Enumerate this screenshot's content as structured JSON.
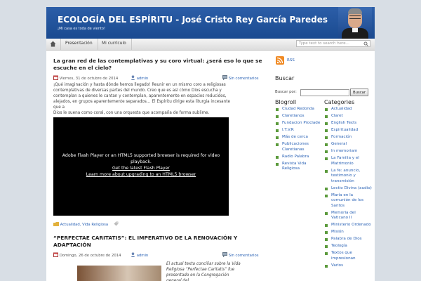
{
  "header": {
    "title": "ECOLOGÍA DEL ESPÍRITU - José Cristo Rey García Paredes",
    "tagline": "¡Mi casa es toda de viento!"
  },
  "nav": {
    "items": [
      "Presentación",
      "Mi currículo"
    ],
    "search_placeholder": "Type text to search here..."
  },
  "posts": [
    {
      "title_line1": "La gran red de las contemplativas y su coro virtual: ¿será eso lo que se",
      "title_line2": "escuche en el cielo?",
      "date": "Viernes, 31 de octubre de 2014",
      "author": "admin",
      "comments": "Sin comentarios",
      "excerpt": [
        "¡Qué imaginación y hasta dónde hemos llegado! Reunir en un mismo coro a religiosas",
        "contemplativas de diversas partes del mundo. Creo que es así cómo Dios escucha y",
        "contemplan a quienes le cantan y contemplan, aparentemente en espacios reducidos,",
        "alejados, en grupos aparentemente separados… El Espíritu dirige esta liturgia incesante que a",
        "Dios le suena como coral, con una orquesta que acompaña de forma sublime."
      ],
      "video": {
        "line1": "Adobe Flash Player or an HTML5 supported browser is required for video",
        "line2": "playback.",
        "link1": "Get the latest Flash Player",
        "link2": "Learn more about upgrading to an HTML5 browser"
      },
      "categories": "Actualidad, Vida Religiosa"
    },
    {
      "title_line1": "“PERFECTAE CARITATIS”: EL IMPERATIVO DE LA RENOVACIÓN Y",
      "title_line2": "ADAPTACIÓN",
      "date": "Domingo, 26 de octubre de 2014",
      "author": "admin",
      "comments": "Sin comentarios",
      "excerpt": [
        "El actual texto conciliar sobre la Vida",
        "Religiosa “Perfectae Caritatis” fue",
        "presentado en la Congregación general del"
      ]
    }
  ],
  "sidebar": {
    "rss": "RSS",
    "search_heading": "Buscar",
    "search_label": "Buscar por:",
    "search_button": "Buscar",
    "blogroll_heading": "Blogroll",
    "blogroll": [
      "Ciudad Redonda",
      "Claretianos",
      "Fundacion Proclade",
      "I.T.V.R",
      "Más de cerca",
      "Publicaciones Claretianas",
      "Radio Palabra",
      "Revista Vida Religiosa"
    ],
    "categories_heading": "Categories",
    "categories": [
      "Actualidad",
      "Claret",
      "English Texts",
      "Espiritualidad",
      "Formación",
      "General",
      "In memoriam",
      "La Familia y el Matrimonio",
      "La fe: anuncio, testimonio y transmisión",
      "Lectio Divina (audio)",
      "María en la comunión de los Santos",
      "Memoria del Vaticano II",
      "Ministerio Ordenado",
      "Misión",
      "Palabra de Dios",
      "Teología",
      "Textos que impresionan",
      "Varios"
    ]
  },
  "colors": {
    "header": "#2c5ea8",
    "link": "#2a62b5",
    "bullet": "#5b9a3c"
  }
}
